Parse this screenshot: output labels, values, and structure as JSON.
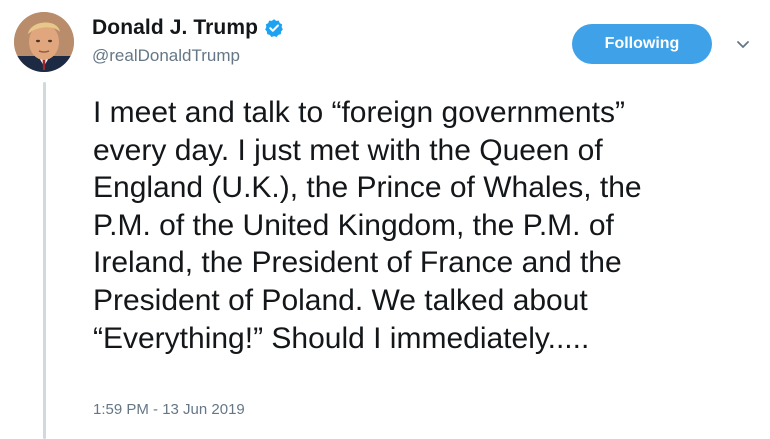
{
  "author": {
    "display_name": "Donald J. Trump",
    "handle": "@realDonaldTrump",
    "verified": true
  },
  "follow_button": {
    "label": "Following"
  },
  "icons": {
    "verified": "verified-badge-icon",
    "menu": "chevron-down-icon"
  },
  "tweet": {
    "text": "I meet and talk to “foreign governments”\nevery day. I just met with the Queen of\nEngland (U.K.), the Prince of Whales, the\nP.M. of the United Kingdom, the P.M. of\nIreland, the President of France and the\nPresident of Poland. We talked about\n“Everything!” Should I immediately.....",
    "timestamp": "1:59 PM - 13 Jun 2019"
  },
  "colors": {
    "accent": "#3fa1e8",
    "verified_badge": "#1da1f2",
    "secondary_text": "#657786",
    "primary_text": "#14171a"
  }
}
